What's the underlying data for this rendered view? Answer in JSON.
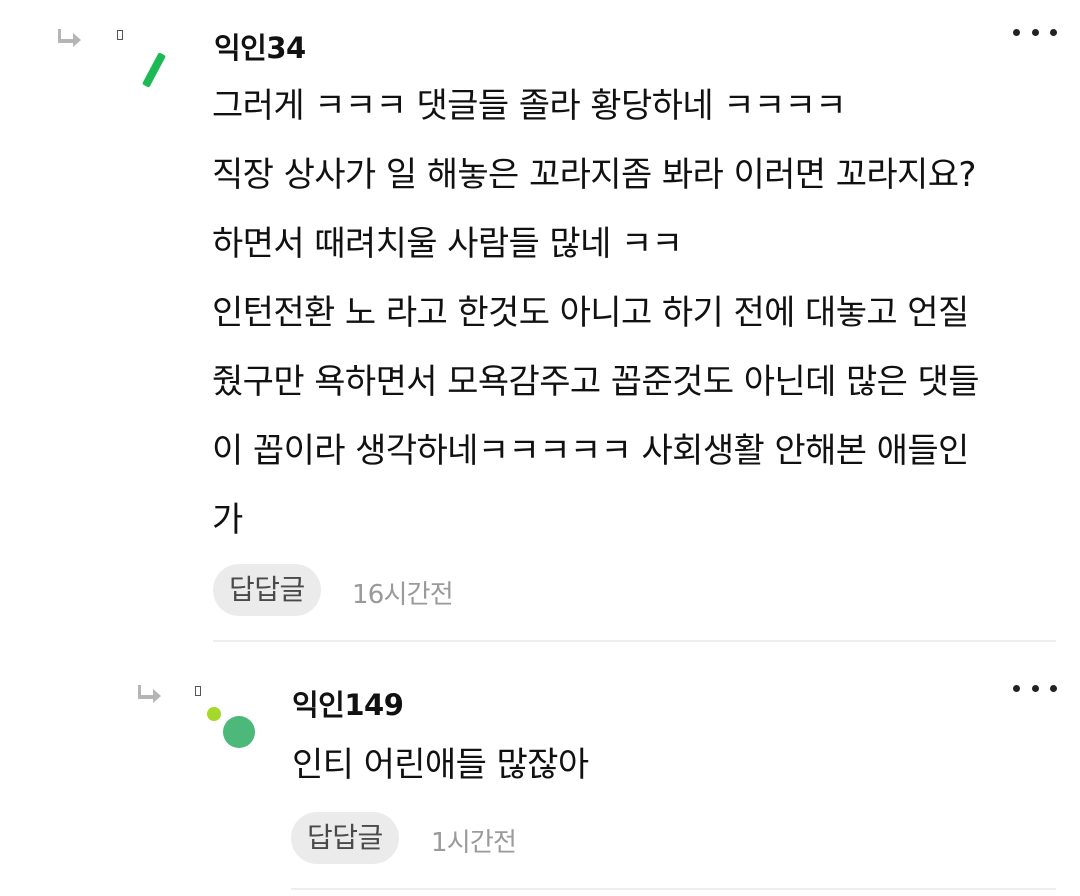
{
  "comments": [
    {
      "author": "익인34",
      "lines": [
        "그러게 ㅋㅋㅋ 댓글들 졸라 황당하네 ㅋㅋㅋㅋ",
        "직장 상사가 일 해놓은 꼬라지좀 봐라 이러면 꼬라지요?",
        "하면서 때려치울 사람들 많네 ㅋㅋ",
        "인턴전환 노 라고 한것도 아니고 하기 전에 대놓고 언질",
        "줬구만 욕하면서 모욕감주고 꼽준것도 아닌데 많은 댓들",
        "이 꼽이라 생각하네ㅋㅋㅋㅋㅋ 사회생활 안해본 애들인",
        "가"
      ],
      "reply_label": "답답글",
      "time": "16시간전"
    },
    {
      "author": "익인149",
      "lines": [
        "인티 어린애들 많잖아"
      ],
      "reply_label": "답답글",
      "time": "1시간전"
    }
  ],
  "colors": {
    "avatar_green_dark": "#1db954",
    "avatar_green_mid": "#4cb97a",
    "avatar_green_light": "#a4d82a",
    "reply_bg": "#ebebeb",
    "time_gray": "#9a9a9a"
  },
  "icons": {
    "reply_arrow": "reply-arrow-icon",
    "more": "more-dots-icon",
    "small_square": "small-square-icon"
  }
}
